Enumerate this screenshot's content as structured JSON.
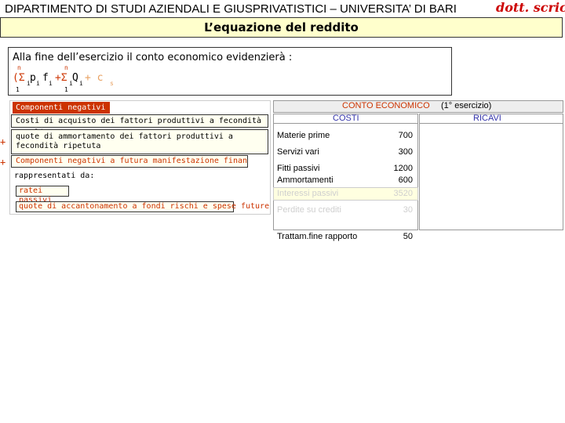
{
  "header": {
    "title": "DIPARTIMENTO DI STUDI AZIENDALI E GIUSPRIVATISTICI – UNIVERSITA’ DI BARI",
    "author": "dott. scricco"
  },
  "slide": {
    "title": "L’equazione del reddito"
  },
  "formula": {
    "intro": "Alla fine dell’esercizio il conto economico evidenzierà :",
    "sup1": "n",
    "sup2": "n",
    "open": "(Σ",
    "p": "p",
    "f": "f",
    "plus_sigma": "+Σ",
    "q": "Q",
    "cs": "+ c",
    "cs_sub": "s",
    "sub_i": "i",
    "lower1": "1",
    "lower2": "1"
  },
  "left_panel": {
    "componenti_negativi": "Componenti negativi",
    "costi_acquisto": "Costi di acquisto dei fattori produttivi a fecondità semplice",
    "quote_ammortamento": "quote di ammortamento dei fattori produttivi a fecondità ripetuta",
    "futura_manifestazione": "Componenti negativi a futura manifestazione finanziaria ...",
    "rappresentati": "rappresentati da:",
    "ratei_passivi": "ratei passivi",
    "quote_accantonamento": "quote di accantonamento a fondi rischi e spese future",
    "plus": "+"
  },
  "conto_economico": {
    "title": "CONTO ECONOMICO",
    "subtitle": "(1° esercizio)",
    "col_costi": "COSTI",
    "col_ricavi": "RICAVI",
    "rows": [
      {
        "label": "Materie prime",
        "value": "700"
      },
      {
        "label": "Servizi vari",
        "value": "300"
      },
      {
        "label": "Fitti passivi",
        "value": "1200"
      },
      {
        "label": "Ammortamenti",
        "value": "600"
      },
      {
        "label": "Interessi passivi",
        "value": "3520"
      },
      {
        "label": "Perdite su crediti",
        "value": "30"
      },
      {
        "label": "Trattam.fine rapporto",
        "value": "50"
      }
    ]
  },
  "colors": {
    "accent_red": "#cc3300",
    "title_band": "#ffffcc",
    "author": "#cc0000"
  }
}
